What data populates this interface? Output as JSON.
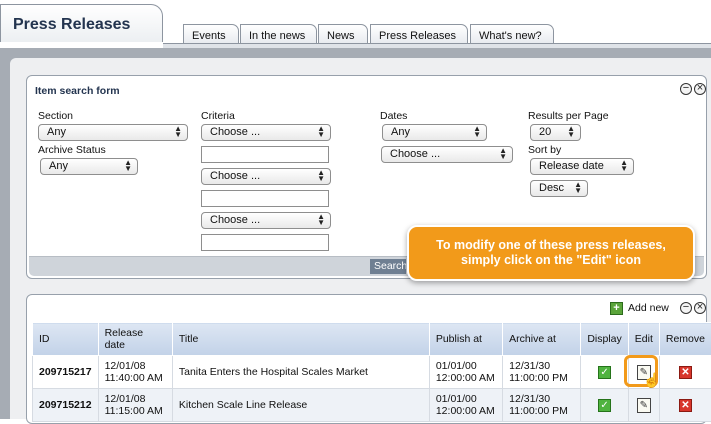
{
  "main_tab": {
    "label": "Press Releases"
  },
  "subtabs": [
    "Events",
    "In the news",
    "News",
    "Press Releases",
    "What's new?"
  ],
  "search_form": {
    "title": "Item search form",
    "section": {
      "label": "Section",
      "value": "Any"
    },
    "archive_status": {
      "label": "Archive Status",
      "value": "Any"
    },
    "criteria": {
      "label": "Criteria",
      "selects": [
        "Choose ...",
        "Choose ...",
        "Choose ..."
      ]
    },
    "dates": {
      "label": "Dates",
      "value": "Any",
      "second": "Choose ..."
    },
    "results_per_page": {
      "label": "Results per Page",
      "value": "20"
    },
    "sort_by": {
      "label": "Sort by",
      "value": "Release date",
      "order": "Desc"
    },
    "search_button": "Search"
  },
  "callout": {
    "text": "To modify one of these press releases, simply click on the \"Edit\" icon"
  },
  "results": {
    "add_new": "Add new",
    "headers": [
      "ID",
      "Release date",
      "Title",
      "Publish at",
      "Archive at",
      "Display",
      "Edit",
      "Remove"
    ],
    "rows": [
      {
        "id": "209715217",
        "release": "12/01/08\n11:40:00 AM",
        "title": "Tanita Enters the Hospital Scales Market",
        "publish": "01/01/00\n12:00:00 AM",
        "archive": "12/31/30\n11:00:00 PM"
      },
      {
        "id": "209715212",
        "release": "12/01/08\n11:15:00 AM",
        "title": "Kitchen Scale Line Release",
        "publish": "01/01/00\n12:00:00 AM",
        "archive": "12/31/30\n11:00:00 PM"
      }
    ]
  },
  "colors": {
    "accent": "#f29a1a",
    "header_blue": "#c2d2e8",
    "frame_gray": "#a6acb4"
  },
  "icons": [
    "collapse-icon",
    "close-icon",
    "add-icon",
    "display-check-icon",
    "edit-icon",
    "remove-icon",
    "pointer-cursor-icon"
  ]
}
